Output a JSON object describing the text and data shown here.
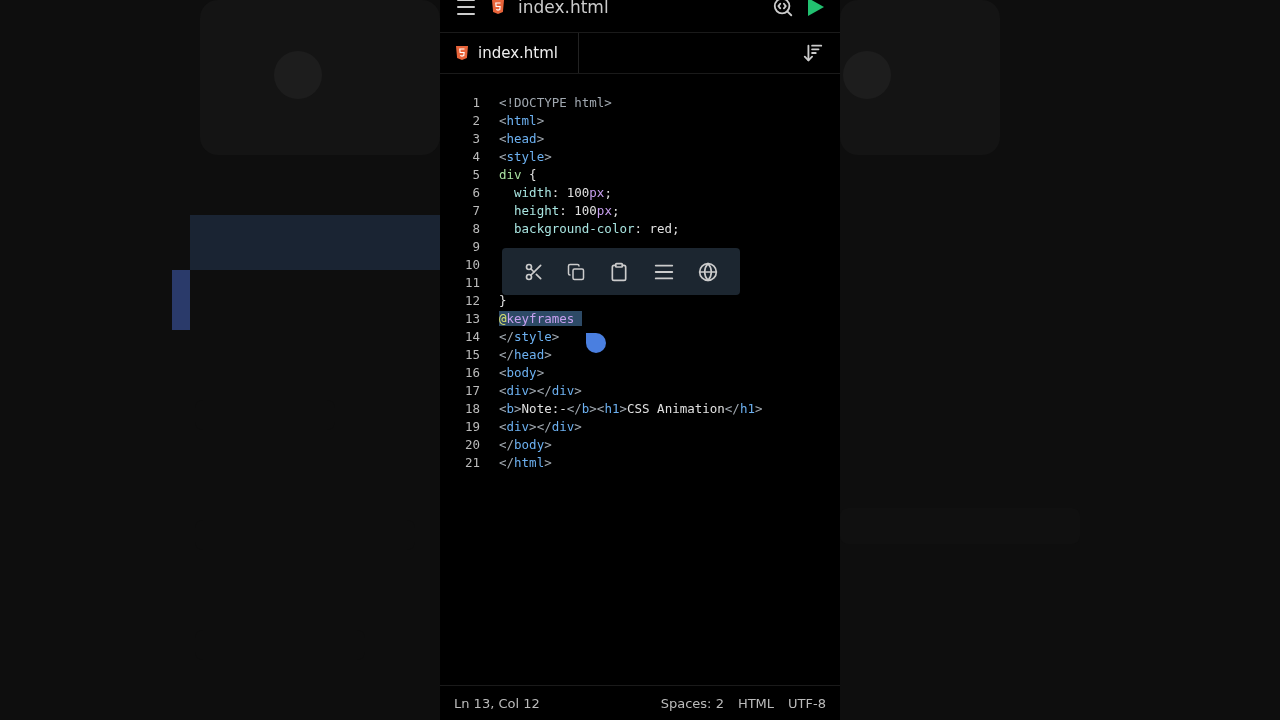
{
  "top_bar": {
    "title": "index.html"
  },
  "tabs": [
    {
      "label": "index.html",
      "selected": true
    }
  ],
  "editor": {
    "lines": [
      {
        "number": "1",
        "tokens": [
          {
            "kind": "punct",
            "text": "<!DOCTYPE html>"
          }
        ]
      },
      {
        "number": "2",
        "tokens": [
          {
            "kind": "punct",
            "text": "<"
          },
          {
            "kind": "tag",
            "text": "html"
          },
          {
            "kind": "punct",
            "text": ">"
          }
        ]
      },
      {
        "number": "3",
        "tokens": [
          {
            "kind": "punct",
            "text": "<"
          },
          {
            "kind": "tag",
            "text": "head"
          },
          {
            "kind": "punct",
            "text": ">"
          }
        ]
      },
      {
        "number": "4",
        "tokens": [
          {
            "kind": "punct",
            "text": "<"
          },
          {
            "kind": "tag",
            "text": "style"
          },
          {
            "kind": "punct",
            "text": ">"
          }
        ]
      },
      {
        "number": "5",
        "tokens": [
          {
            "kind": "selector",
            "text": "div"
          },
          {
            "kind": "text",
            "text": " {"
          }
        ]
      },
      {
        "number": "6",
        "tokens": [
          {
            "kind": "prop",
            "text": "  width"
          },
          {
            "kind": "text",
            "text": ": 100"
          },
          {
            "kind": "unit",
            "text": "px"
          },
          {
            "kind": "text",
            "text": ";"
          }
        ]
      },
      {
        "number": "7",
        "tokens": [
          {
            "kind": "prop",
            "text": "  height"
          },
          {
            "kind": "text",
            "text": ": 100"
          },
          {
            "kind": "unit",
            "text": "px"
          },
          {
            "kind": "text",
            "text": ";"
          }
        ]
      },
      {
        "number": "8",
        "tokens": [
          {
            "kind": "prop",
            "text": "  background-color"
          },
          {
            "kind": "text",
            "text": ": red;"
          }
        ]
      },
      {
        "number": "9"
      },
      {
        "number": "10"
      },
      {
        "number": "11"
      },
      {
        "number": "12",
        "tokens": [
          {
            "kind": "text",
            "text": "}"
          }
        ]
      },
      {
        "number": "13",
        "selected": true,
        "tokens": [
          {
            "kind": "at",
            "text": "@"
          },
          {
            "kind": "unit",
            "text": "keyframes "
          }
        ]
      },
      {
        "number": "14",
        "tokens": [
          {
            "kind": "punct",
            "text": "</"
          },
          {
            "kind": "tag",
            "text": "style"
          },
          {
            "kind": "punct",
            "text": ">"
          }
        ]
      },
      {
        "number": "15",
        "tokens": [
          {
            "kind": "punct",
            "text": "</"
          },
          {
            "kind": "tag",
            "text": "head"
          },
          {
            "kind": "punct",
            "text": ">"
          }
        ]
      },
      {
        "number": "16",
        "tokens": [
          {
            "kind": "punct",
            "text": "<"
          },
          {
            "kind": "tag",
            "text": "body"
          },
          {
            "kind": "punct",
            "text": ">"
          }
        ]
      },
      {
        "number": "17",
        "tokens": [
          {
            "kind": "punct",
            "text": "<"
          },
          {
            "kind": "tag",
            "text": "div"
          },
          {
            "kind": "punct",
            "text": "></"
          },
          {
            "kind": "tag",
            "text": "div"
          },
          {
            "kind": "punct",
            "text": ">"
          }
        ]
      },
      {
        "number": "18",
        "tokens": [
          {
            "kind": "punct",
            "text": "<"
          },
          {
            "kind": "tag",
            "text": "b"
          },
          {
            "kind": "punct",
            "text": ">"
          },
          {
            "kind": "text",
            "text": "Note:-"
          },
          {
            "kind": "punct",
            "text": "</"
          },
          {
            "kind": "tag",
            "text": "b"
          },
          {
            "kind": "punct",
            "text": "><"
          },
          {
            "kind": "tag",
            "text": "h1"
          },
          {
            "kind": "punct",
            "text": ">"
          },
          {
            "kind": "text",
            "text": "CSS Animation"
          },
          {
            "kind": "punct",
            "text": "</"
          },
          {
            "kind": "tag",
            "text": "h1"
          },
          {
            "kind": "punct",
            "text": ">"
          }
        ]
      },
      {
        "number": "19",
        "tokens": [
          {
            "kind": "punct",
            "text": "<"
          },
          {
            "kind": "tag",
            "text": "div"
          },
          {
            "kind": "punct",
            "text": "></"
          },
          {
            "kind": "tag",
            "text": "div"
          },
          {
            "kind": "punct",
            "text": ">"
          }
        ]
      },
      {
        "number": "20",
        "tokens": [
          {
            "kind": "punct",
            "text": "</"
          },
          {
            "kind": "tag",
            "text": "body"
          },
          {
            "kind": "punct",
            "text": ">"
          }
        ]
      },
      {
        "number": "21",
        "tokens": [
          {
            "kind": "punct",
            "text": "</"
          },
          {
            "kind": "tag",
            "text": "html"
          },
          {
            "kind": "punct",
            "text": ">"
          }
        ]
      }
    ]
  },
  "status_bar": {
    "position": "Ln 13, Col 12",
    "indent": "Spaces: 2",
    "language": "HTML",
    "encoding": "UTF-8"
  }
}
